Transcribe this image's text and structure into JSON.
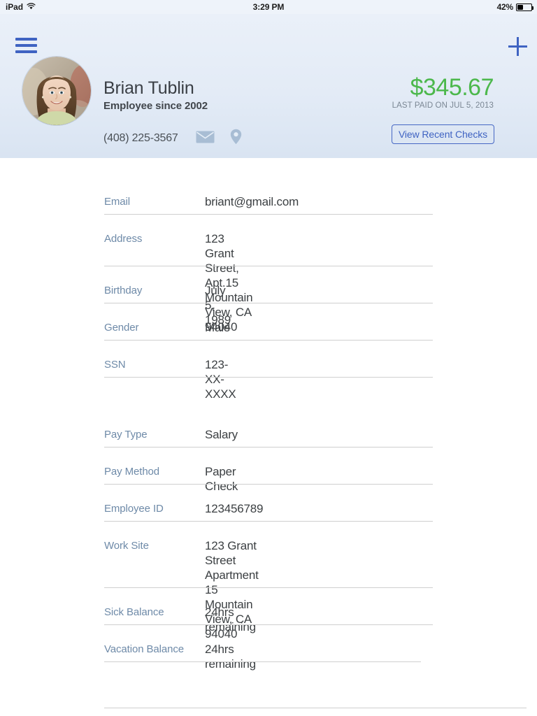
{
  "statusbar": {
    "device": "iPad",
    "wifi_icon": "wifi-icon",
    "time": "3:29 PM",
    "battery_percent": "42%",
    "battery_icon": "battery-icon"
  },
  "navbar": {
    "menu_icon": "hamburger-menu-icon",
    "add_icon": "plus-icon"
  },
  "profile": {
    "avatar_icon": "employee-avatar-photo",
    "name": "Brian Tublin",
    "tenure": "Employee since 2002",
    "phone": "(408) 225-3567",
    "email_icon": "envelope-icon",
    "location_icon": "map-pin-icon",
    "pay_amount": "$345.67",
    "pay_amount_color": "#4cb84c",
    "last_paid": "LAST PAID ON JUL 5, 2013",
    "view_checks_label": "View Recent Checks",
    "accent_color": "#3f63c2",
    "header_bg": "#e3ebf6"
  },
  "sections": [
    {
      "name": "personal-info",
      "fields": [
        {
          "label": "Email",
          "value": "briant@gmail.com"
        },
        {
          "label": "Address",
          "value": "123 Grant Street, Apt.15\nMountain View, CA 94040"
        },
        {
          "label": "Birthday",
          "value": "July 5, 1989"
        },
        {
          "label": "Gender",
          "value": "Male"
        },
        {
          "label": "SSN",
          "value": "123-XX-XXXX"
        }
      ]
    },
    {
      "name": "employment-info",
      "fields": [
        {
          "label": "Pay Type",
          "value": "Salary"
        },
        {
          "label": "Pay Method",
          "value": "Paper Check"
        },
        {
          "label": "Employee ID",
          "value": "123456789"
        },
        {
          "label": "Work Site",
          "value": "123 Grant Street\nApartment 15\nMountain View, CA 94040"
        },
        {
          "label": "Sick Balance",
          "value": "24hrs remaining"
        },
        {
          "label": "Vacation Balance",
          "value": "24hrs remaining"
        }
      ]
    }
  ]
}
